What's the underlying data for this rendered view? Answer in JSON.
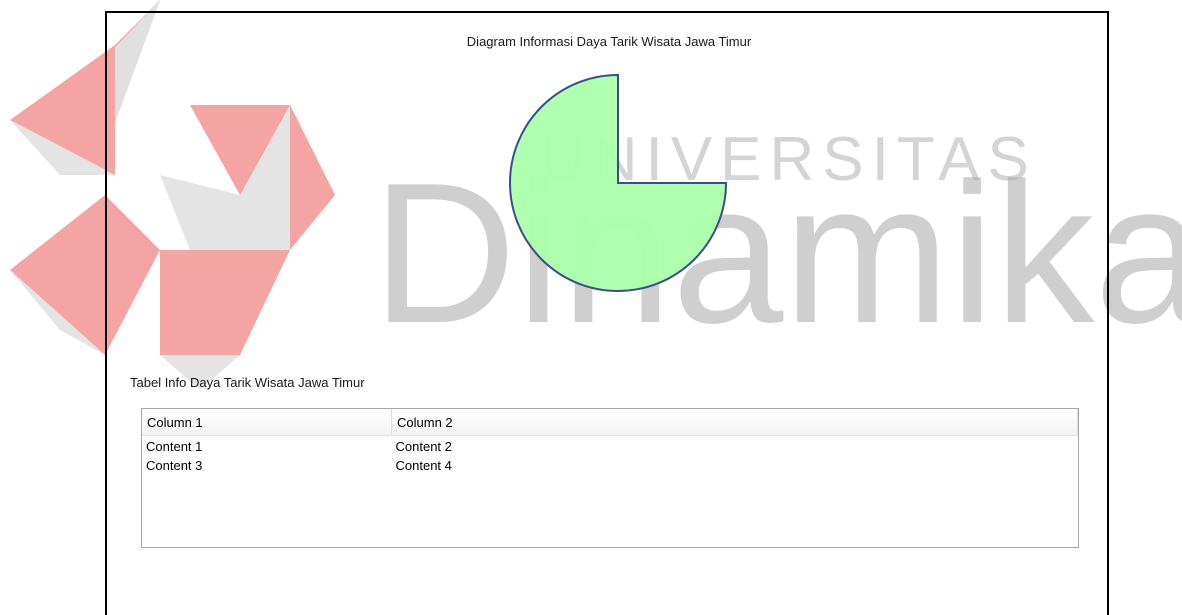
{
  "watermark": {
    "line1": "UNIVERSITAS",
    "line2": "Dinamika"
  },
  "chart_data": {
    "type": "pie",
    "title": "Diagram Informasi Daya Tarik Wisata Jawa Timur",
    "slices": [
      {
        "label": "",
        "value": 75,
        "color": "#aaffaa"
      },
      {
        "label": "",
        "value": 25,
        "color": "#ffffff"
      }
    ],
    "stroke_color": "#3b4d8f"
  },
  "table": {
    "caption": "Tabel Info Daya Tarik Wisata Jawa Timur",
    "columns": [
      "Column 1",
      "Column 2"
    ],
    "rows": [
      [
        "Content 1",
        "Content 2"
      ],
      [
        "Content 3",
        "Content 4"
      ]
    ]
  }
}
